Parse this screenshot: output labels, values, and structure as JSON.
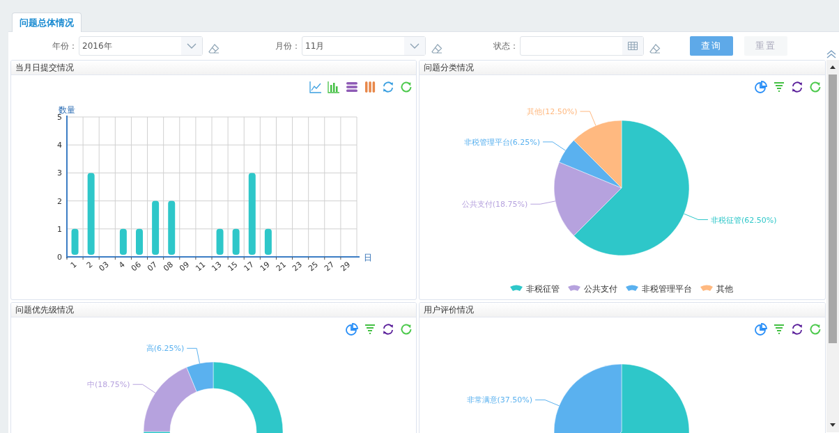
{
  "tabs": [
    {
      "label": "问题总体情况",
      "selected": true
    }
  ],
  "filters": [
    {
      "label": "年份：",
      "kind": "select",
      "value": "2016年"
    },
    {
      "label": "月份：",
      "kind": "select",
      "value": "11月"
    },
    {
      "label": "状态：",
      "kind": "picker"
    }
  ],
  "buttons": [
    {
      "label": "查询",
      "disabled": false
    },
    {
      "label": "重置",
      "disabled": true
    }
  ],
  "panels": [
    {
      "title": "当月日提交情况",
      "chart_data": {
        "type": "bar",
        "xlabel": "日",
        "ylabel": "数量",
        "categories": [
          "1",
          "2",
          "03",
          "4",
          "06",
          "07",
          "08",
          "09",
          "11",
          "13",
          "15",
          "17",
          "19",
          "21",
          "23",
          "25",
          "27",
          "29"
        ],
        "values": [
          1,
          3,
          0,
          1,
          1,
          2,
          2,
          0,
          0,
          1,
          1,
          3,
          1,
          0,
          0,
          0,
          0,
          0
        ],
        "color": "#2ec7c9",
        "ylim": [
          0,
          5
        ],
        "yticks": [
          0,
          1,
          2,
          3,
          4,
          5
        ],
        "grid": true
      }
    },
    {
      "title": "问题分类情况",
      "chart_data": {
        "type": "pie",
        "legend": true,
        "categories": [
          "非税征管",
          "公共支付",
          "非税管理平台",
          "其他"
        ],
        "values": [
          62.5,
          18.75,
          6.25,
          12.5
        ],
        "colors": [
          "#2ec7c9",
          "#b6a2de",
          "#5ab1ef",
          "#ffb980"
        ],
        "value_labels": [
          "非税征管(62.50%)",
          "公共支付(18.75%)",
          "非税管理平台(6.25%)",
          "其他(12.50%)"
        ]
      }
    },
    {
      "title": "问题优先级情况",
      "chart_data": {
        "type": "donut",
        "values": [
          75,
          18.75,
          6.25
        ],
        "colors": [
          "#2ec7c9",
          "#b6a2de",
          "#5ab1ef"
        ],
        "value_labels": [
          null,
          "中(18.75%)",
          "高(6.25%)"
        ]
      }
    },
    {
      "title": "用户评价情况",
      "chart_data": {
        "type": "pie",
        "values": [
          62.5,
          37.5
        ],
        "colors": [
          "#2ec7c9",
          "#5ab1ef"
        ],
        "value_labels": [
          null,
          "非常满意(37.50%)"
        ]
      }
    }
  ]
}
